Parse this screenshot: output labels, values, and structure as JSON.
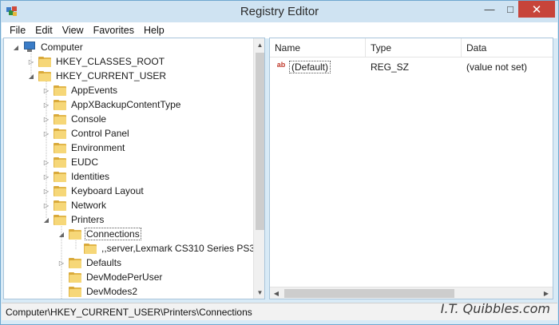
{
  "window": {
    "title": "Registry Editor"
  },
  "menu": [
    "File",
    "Edit",
    "View",
    "Favorites",
    "Help"
  ],
  "tree": {
    "root": "Computer",
    "items": [
      {
        "label": "HKEY_CLASSES_ROOT",
        "expander": "collapsed"
      },
      {
        "label": "HKEY_CURRENT_USER",
        "expander": "expanded"
      },
      {
        "label": "AppEvents",
        "expander": "collapsed"
      },
      {
        "label": "AppXBackupContentType",
        "expander": "collapsed"
      },
      {
        "label": "Console",
        "expander": "collapsed"
      },
      {
        "label": "Control Panel",
        "expander": "collapsed"
      },
      {
        "label": "Environment",
        "expander": "none"
      },
      {
        "label": "EUDC",
        "expander": "collapsed"
      },
      {
        "label": "Identities",
        "expander": "collapsed"
      },
      {
        "label": "Keyboard Layout",
        "expander": "collapsed"
      },
      {
        "label": "Network",
        "expander": "collapsed"
      },
      {
        "label": "Printers",
        "expander": "expanded"
      },
      {
        "label": "Connections",
        "expander": "expanded",
        "selected": true
      },
      {
        "label": ",,server,Lexmark CS310 Series PS3",
        "expander": "none"
      },
      {
        "label": "Defaults",
        "expander": "collapsed"
      },
      {
        "label": "DevModePerUser",
        "expander": "none"
      },
      {
        "label": "DevModes2",
        "expander": "none"
      }
    ]
  },
  "list": {
    "columns": [
      "Name",
      "Type",
      "Data"
    ],
    "rows": [
      {
        "name": "(Default)",
        "type": "REG_SZ",
        "data": "(value not set)"
      }
    ]
  },
  "status": {
    "path": "Computer\\HKEY_CURRENT_USER\\Printers\\Connections"
  },
  "watermark": "I.T. Quibbles.com",
  "colors": {
    "close_button": "#c7443a",
    "folder": "#f6d778",
    "frame": "#d8eaf6"
  }
}
